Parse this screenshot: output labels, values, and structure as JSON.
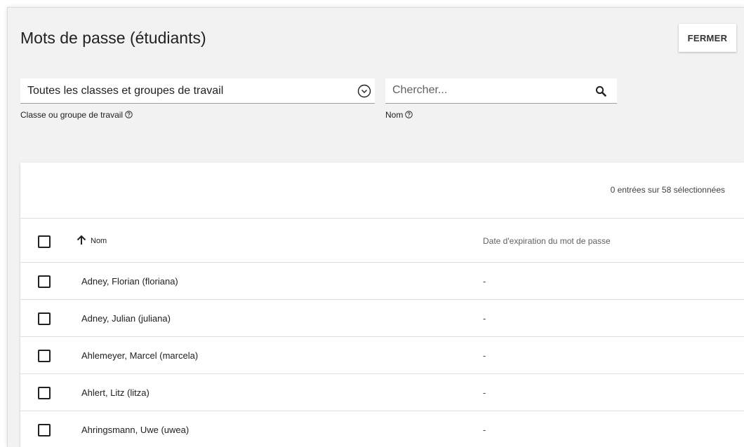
{
  "page": {
    "title": "Mots de passe (étudiants)",
    "close_label": "FERMER"
  },
  "filters": {
    "class_select": {
      "value": "Toutes les classes et groupes de travail",
      "caption": "Classe ou groupe de travail",
      "icon": "chevron-down-circle-icon"
    },
    "search": {
      "placeholder": "Chercher...",
      "value": "",
      "caption": "Nom",
      "icon": "search-icon"
    }
  },
  "table": {
    "selection_status": "0 entrées sur 58 sélectionnées",
    "columns": {
      "name": "Nom",
      "expiration": "Date d'expiration du mot de passe"
    },
    "sort": {
      "column": "name",
      "direction": "ascending",
      "icon": "arrow-up-icon"
    },
    "rows": [
      {
        "name": "Adney, Florian (floriana)",
        "expiration": "-"
      },
      {
        "name": "Adney, Julian (juliana)",
        "expiration": "-"
      },
      {
        "name": "Ahlemeyer, Marcel (marcela)",
        "expiration": "-"
      },
      {
        "name": "Ahlert, Litz (litza)",
        "expiration": "-"
      },
      {
        "name": "Ahringsmann, Uwe (uwea)",
        "expiration": "-"
      }
    ]
  },
  "colors": {
    "background": "#f2f2f2",
    "card": "#ffffff",
    "text": "#212121",
    "divider": "#e0e0e0"
  }
}
